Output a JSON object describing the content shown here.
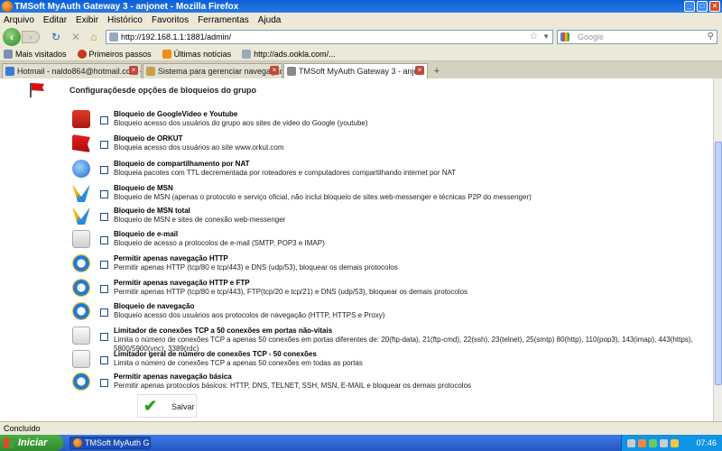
{
  "window": {
    "title": "TMSoft MyAuth Gateway 3 - anjonet - Mozilla Firefox"
  },
  "menu": [
    "Arquivo",
    "Editar",
    "Exibir",
    "Histórico",
    "Favoritos",
    "Ferramentas",
    "Ajuda"
  ],
  "nav": {
    "url": "http://192.168.1.1:1881/admin/",
    "search_placeholder": "Google"
  },
  "bookmarks": [
    "Mais visitados",
    "Primeiros passos",
    "Últimas notícias",
    "http://ads.ookla.com/..."
  ],
  "tabs": [
    {
      "label": "Hotmail - naldo864@hotmail.com - Win..."
    },
    {
      "label": "Sistema para gerenciar navegação em ..."
    },
    {
      "label": "TMSoft MyAuth Gateway 3 - anjo..."
    }
  ],
  "page": {
    "title": "Configuraçõesde opções de bloqueios do grupo",
    "options": [
      {
        "icon": "youtube-icon",
        "title": "Bloqueio de GoogleVideo e Youtube",
        "desc": "Bloqueio acesso dos usuários do grupo aos sites de video do Google (youtube)"
      },
      {
        "icon": "orkut-icon",
        "title": "Bloqueio de ORKUT",
        "desc": "Bloqueia acesso dos usuários ao site www.orkut.com"
      },
      {
        "icon": "nat-icon",
        "title": "Bloqueio de compartilhamento por NAT",
        "desc": "Bloqueia pacotes com TTL decrementada por roteadores e computadores compartilhando internet por NAT"
      },
      {
        "icon": "msn-icon",
        "title": "Bloqueio de MSN",
        "desc": "Bloqueio de MSN (apenas o protocolo e serviço oficial, não inclui bloqueio de sites web-messenger e técnicas P2P do messenger)"
      },
      {
        "icon": "msn-icon",
        "title": "Bloqueio de MSN total",
        "desc": "Bloqueio de MSN e sites de conexão web-messenger"
      },
      {
        "icon": "email-icon",
        "title": "Bloqueio de e-mail",
        "desc": "Bloqueio de acesso a protocolos de e-mail (SMTP, POP3 e IMAP)"
      },
      {
        "icon": "ie-icon",
        "title": "Permitir apenas navegação HTTP",
        "desc": "Permitir apenas HTTP (tcp/80 e tcp/443) e DNS (udp/53), bloquear os demais protocolos"
      },
      {
        "icon": "ie-icon",
        "title": "Permitir apenas navegação HTTP e FTP",
        "desc": "Permitir apenas HTTP (tcp/80 e tcp/443), FTP(tcp/20 e tcp/21) e DNS (udp/53), bloquear os demais protocolos"
      },
      {
        "icon": "ie-icon",
        "title": "Bloqueio de navegação",
        "desc": "Bloqueio acesso dos usuários aos protocolos de navegação (HTTP, HTTPS e Proxy)"
      },
      {
        "icon": "chart-icon",
        "title": "Limitador de conexões TCP a 50 conexões em portas não-vitais",
        "desc": "Limita o número de conexões TCP a apenas 50 conexões em portas diferentes de: 20(ftp-data), 21(ftp-cmd), 22(ssh), 23(telnet), 25(smtp) 80(http), 110(pop3), 143(imap), 443(https), 5800/5900(vnc), 3389(rdc)"
      },
      {
        "icon": "chart-icon",
        "title": "Limitador geral de número de conexões TCP - 50 conexões",
        "desc": "Limita o número de conexões TCP a apenas 50 conexões em todas as portas"
      },
      {
        "icon": "ie-icon",
        "title": "Permitir apenas navegação básica",
        "desc": "Permitir apenas protocolos básicos: HTTP, DNS, TELNET, SSH, MSN, E-MAIL e bloquear os demais protocolos"
      }
    ],
    "save_label": "Salvar"
  },
  "status": "Concluído",
  "taskbar": {
    "start_label": "Iniciar",
    "item_label": "TMSoft MyAuth Gate...",
    "clock": "07:46"
  }
}
